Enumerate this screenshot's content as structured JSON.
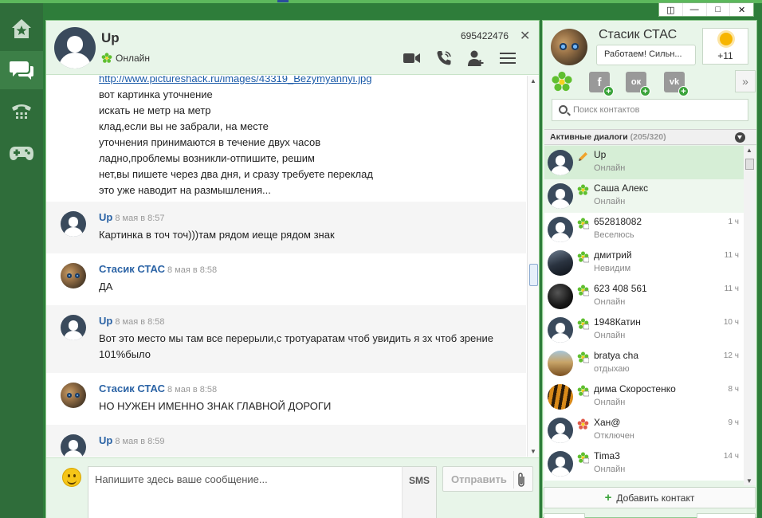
{
  "window": {
    "controls": [
      "◫",
      "—",
      "□",
      "✕"
    ]
  },
  "nav": {
    "items": [
      {
        "name": "home",
        "icon": "house-star-icon"
      },
      {
        "name": "chats",
        "icon": "chat-bubbles-icon"
      },
      {
        "name": "calls",
        "icon": "phone-icon"
      },
      {
        "name": "games",
        "icon": "gamepad-icon"
      }
    ]
  },
  "chat": {
    "contact_name": "Up",
    "contact_status": "Онлайн",
    "contact_uin": "695422476",
    "close_glyph": "✕",
    "first_message": {
      "lines": [
        "http://www.pictureshack.ru/images/43319_Bezymyannyi.jpg",
        "вот картинка уточнение",
        "искать не метр на метр",
        "клад,если вы не забрали, на месте",
        "уточнения принимаются в течение двух часов",
        "ладно,проблемы возникли-отпишите, решим",
        "нет,вы пишете через два дня, и сразу требуете переклад",
        "это уже наводит на размышления..."
      ]
    },
    "messages": [
      {
        "author": "Up",
        "time": "8 мая в 8:57",
        "text": "Картинка в точ точ)))там рядом иеще рядом знак"
      },
      {
        "author": "Стасик СТАС",
        "time": "8 мая в 8:58",
        "text": "ДА"
      },
      {
        "author": "Up",
        "time": "8 мая в 8:58",
        "text": "Вот это место мы там все перерыли,с тротуаратам чтоб увидить я зх чтоб зрение 101%было"
      },
      {
        "author": "Стасик СТАС",
        "time": "8 мая в 8:58",
        "text": "НО НУЖЕН ИМЕННО ЗНАК ГЛАВНОЙ ДОРОГИ"
      },
      {
        "author": "Up",
        "time": "8 мая в 8:59",
        "text": ""
      }
    ],
    "composer": {
      "placeholder": "Напишите здесь ваше сообщение...",
      "sms_label": "SMS",
      "send_label": "Отправить"
    }
  },
  "profile": {
    "name": "Стасик СТАС",
    "status_text": "Работаем! Сильн...",
    "weather_temp": "+11"
  },
  "sidebar": {
    "collapse_glyph": "»",
    "social": [
      {
        "letter": "f",
        "icon": "facebook-add-icon"
      },
      {
        "letter": "ок",
        "icon": "odnoklassniki-add-icon"
      },
      {
        "letter": "vk",
        "icon": "vkontakte-add-icon"
      }
    ],
    "search_placeholder": "Поиск контактов",
    "list_title": "Активные диалоги",
    "list_count": "(205/320)",
    "add_contact": "Добавить контакт"
  },
  "contacts": [
    {
      "name": "Up",
      "sub": "Онлайн",
      "time": "",
      "avatar": "generic",
      "status": "typing"
    },
    {
      "name": "Саша Алекс",
      "sub": "Онлайн",
      "time": "",
      "avatar": "generic",
      "status": "online"
    },
    {
      "name": "652818082",
      "sub": "Веселюсь",
      "time": "1 ч",
      "avatar": "generic",
      "status": "online-msg"
    },
    {
      "name": "дмитрий",
      "sub": "Невидим",
      "time": "11 ч",
      "avatar": "car",
      "status": "online-msg"
    },
    {
      "name": "623 408 561",
      "sub": "Онлайн",
      "time": "11 ч",
      "avatar": "ball",
      "status": "online-msg"
    },
    {
      "name": "1948Катин",
      "sub": "Онлайн",
      "time": "10 ч",
      "avatar": "generic",
      "status": "online-msg"
    },
    {
      "name": "bratya cha",
      "sub": "отдыхаю",
      "time": "12 ч",
      "avatar": "sand",
      "status": "online-msg"
    },
    {
      "name": "дима Скоростенко",
      "sub": "Онлайн",
      "time": "8 ч",
      "avatar": "tiger",
      "status": "online-msg"
    },
    {
      "name": "Хан@",
      "sub": "Отключен",
      "time": "9 ч",
      "avatar": "generic",
      "status": "offline"
    },
    {
      "name": "Tima3",
      "sub": "Онлайн",
      "time": "14 ч",
      "avatar": "generic",
      "status": "online-msg"
    }
  ],
  "colors": {
    "accent_green": "#2f6d3a",
    "panel_green": "#e8f5e9",
    "link_blue": "#2b63a5"
  }
}
